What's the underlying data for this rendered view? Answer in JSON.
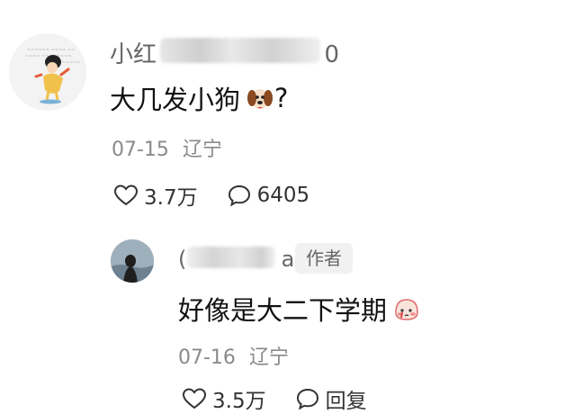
{
  "comment": {
    "username_visible": "小红",
    "username_suffix_visible": "0",
    "text": "大几发小狗",
    "text_end": "?",
    "emoji_icon": "dog-face-emoji",
    "date": "07-15",
    "location": "辽宁",
    "like_count": "3.7万",
    "reply_count": "6405",
    "like_icon": "heart-outline-icon",
    "comment_icon": "speech-bubble-icon"
  },
  "reply": {
    "username_prefix_visible": "(",
    "username_suffix_visible": "a",
    "author_badge": "作者",
    "text": "好像是大二下学期",
    "emoji_icon": "crying-blush-emoji",
    "date": "07-16",
    "location": "辽宁",
    "like_count": "3.5万",
    "reply_label": "回复",
    "like_icon": "heart-outline-icon",
    "comment_icon": "speech-bubble-icon"
  },
  "colors": {
    "background": "#ffffff",
    "text_primary": "#111111",
    "text_meta": "#8a8a8a",
    "badge_bg": "#f1f1f1"
  }
}
